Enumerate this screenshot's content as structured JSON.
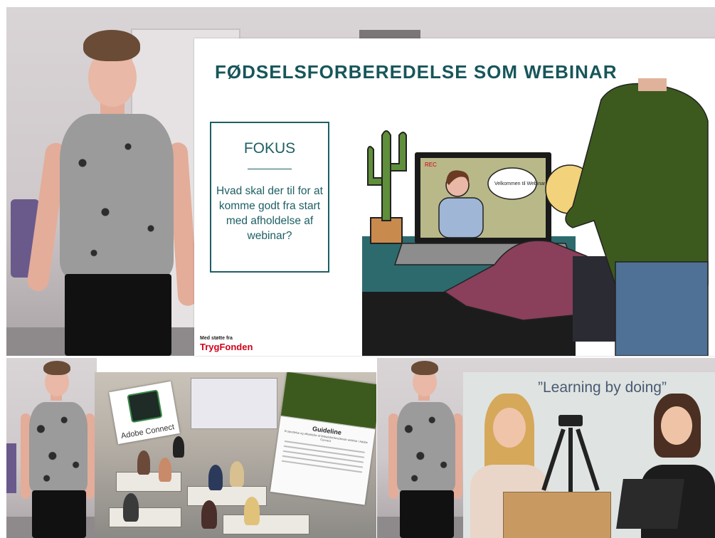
{
  "slide": {
    "title": "FØDSELSFORBEREDELSE SOM WEBINAR",
    "focus_heading": "FOKUS",
    "focus_question": "Hvad skal der til for at komme godt fra start med afholdelse af webinar?",
    "rec_label": "REC",
    "bubble_text": "Velkommen til Webinaret",
    "support_label": "Med støtte fra",
    "sponsor_logo": "TrygFonden"
  },
  "bottom_middle": {
    "adobe_label": "Adobe Connect",
    "doc_title": "Guideline",
    "doc_subtitle": "til oprettelse og afholdelse af fødselsforberedende webinar i Adobe Connect"
  },
  "bottom_right": {
    "quote": "”Learning by doing”"
  },
  "colors": {
    "slide_accent": "#17565a",
    "sponsor_red": "#d0021b"
  }
}
